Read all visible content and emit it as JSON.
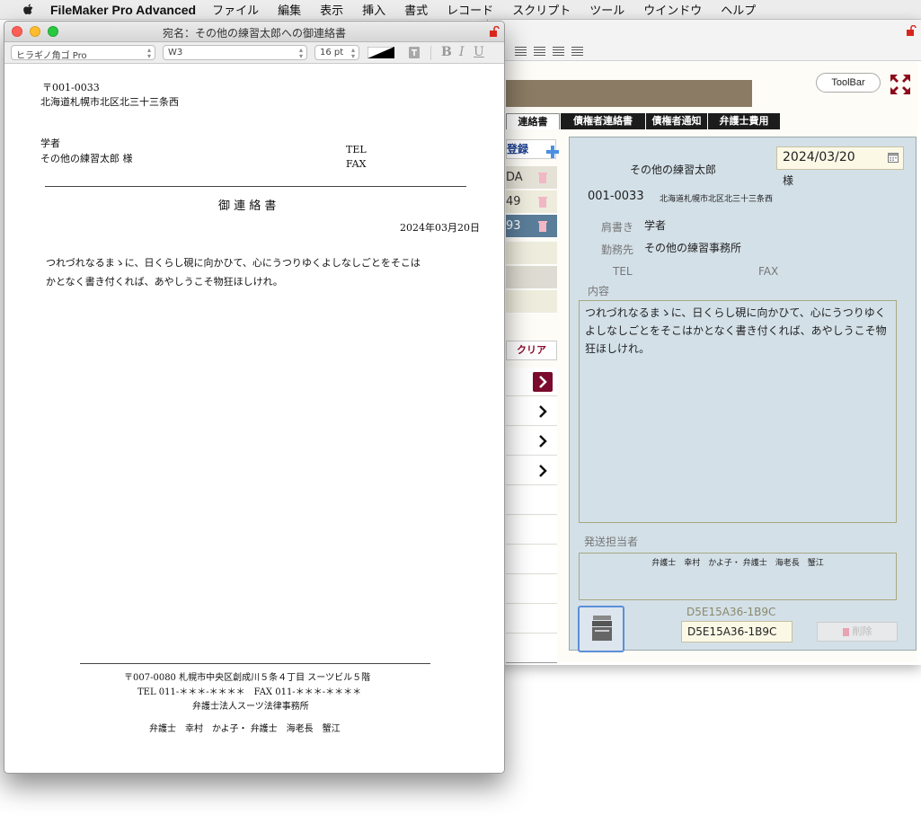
{
  "menubar": {
    "app_name": "FileMaker Pro Advanced",
    "items": [
      "ファイル",
      "編集",
      "表示",
      "挿入",
      "書式",
      "レコード",
      "スクリプト",
      "ツール",
      "ウインドウ",
      "ヘルプ"
    ]
  },
  "doc_window": {
    "title": "宛名：その他の練習太郎への御連絡書",
    "format_bar": {
      "font": "ヒラギノ角ゴ Pro",
      "style": "W3",
      "size": "16 pt",
      "bold": "B",
      "italic": "I",
      "underline": "U"
    },
    "postal": "〒001-0033",
    "address": "北海道札幌市北区北三十三条西",
    "honorific_title": "学者",
    "recipient": "その他の練習太郎 様",
    "tel_label": "TEL",
    "fax_label": "FAX",
    "heading": "御 連 絡 書",
    "date": "2024年03月20日",
    "body_line1": "つれづれなるまゝに、日くらし硯に向かひて、心にうつりゆくよしなしごとをそこは",
    "body_line2": "かとなく書き付くれば、あやしうこそ物狂ほしけれ。",
    "footer_address": "〒007-0080 札幌市中央区創成川５条４丁目 スーツビル５階",
    "footer_telfax": "TEL 011-＊＊＊-＊＊＊＊　FAX 011-＊＊＊-＊＊＊＊",
    "footer_firm": "弁護士法人スーツ法律事務所",
    "footer_lawyers": "弁護士　幸村　かよ子・ 弁護士　海老長　蟹江"
  },
  "bg_window": {
    "toolbar_button": "ToolBar",
    "tabs": [
      "連絡書",
      "債権者連絡書",
      "債権者通知",
      "弁護士費用"
    ],
    "register_button": "登録",
    "list_rows": [
      "DA",
      "49",
      "93"
    ],
    "clear_button": "クリア",
    "detail": {
      "name": "その他の練習太郎",
      "sama": "様",
      "date": "2024/03/20",
      "postal": "001-0033",
      "address": "北海道札幌市北区北三十三条西",
      "title_label": "肩書き",
      "title_value": "学者",
      "work_label": "勤務先",
      "work_value": "その他の練習事務所",
      "tel_label": "TEL",
      "fax_label": "FAX",
      "content_label": "内容",
      "content": "つれづれなるまゝに、日くらし硯に向かひて、心にうつりゆくよしなしごとをそこはかとなく書き付くれば、あやしうこそ物狂ほしけれ。",
      "sender_label": "発送担当者",
      "sender_value": "弁護士　幸村　かよ子・ 弁護士　海老長　蟹江",
      "record_id_label": "D5E15A36-1B9C",
      "record_id": "D5E15A36-1B9C",
      "delete_button": "削除"
    }
  },
  "colors": {
    "accent_red": "#7a0b2c",
    "panel_blue": "#d3e0e8",
    "tab_dark": "#1c1c1c"
  }
}
